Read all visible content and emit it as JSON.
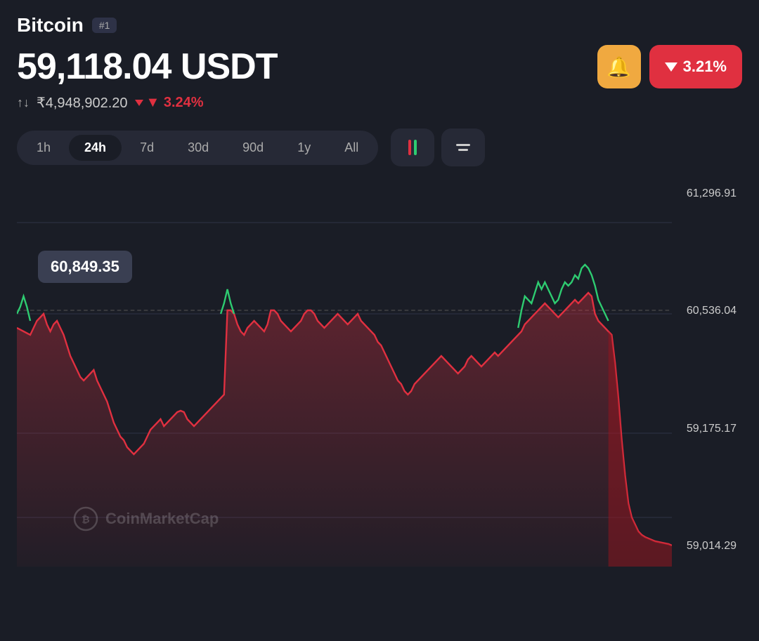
{
  "header": {
    "coin_name": "Bitcoin",
    "rank_badge": "#1"
  },
  "price": {
    "main": "59,118.04 USDT",
    "inr": "₹4,948,902.20",
    "change_percent": "▼ 3.24%",
    "change_24h_percent": "3.21%"
  },
  "bell_icon": "🔔",
  "timeframes": [
    {
      "label": "1h",
      "active": false
    },
    {
      "label": "24h",
      "active": true
    },
    {
      "label": "7d",
      "active": false
    },
    {
      "label": "30d",
      "active": false
    },
    {
      "label": "90d",
      "active": false
    },
    {
      "label": "1y",
      "active": false
    },
    {
      "label": "All",
      "active": false
    }
  ],
  "chart": {
    "price_tooltip": "60,849.35",
    "labels": [
      {
        "value": "61,296.91"
      },
      {
        "value": "60,536.04"
      },
      {
        "value": "59,175.17"
      },
      {
        "value": "59,014.29"
      }
    ],
    "watermark": "CoinMarketCap"
  }
}
